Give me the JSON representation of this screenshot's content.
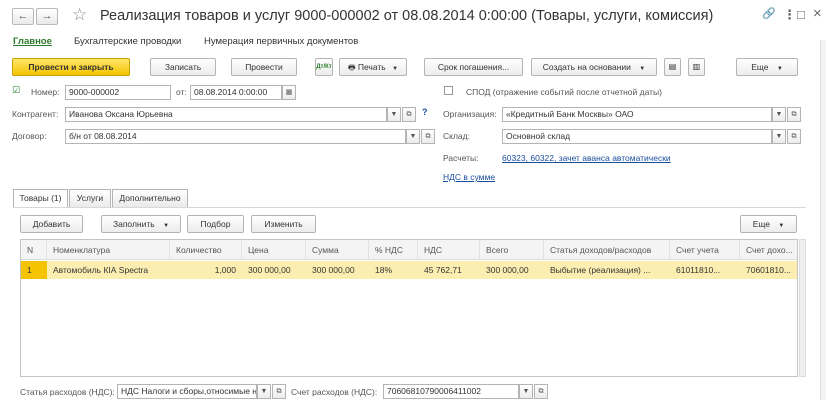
{
  "window": {
    "title": "Реализация товаров и услуг 9000-000002 от 08.08.2014 0:00:00 (Товары, услуги, комиссия)",
    "back_glyph": "←",
    "forward_glyph": "→",
    "star_glyph": "☆",
    "link_glyph": "🔗",
    "more_glyph": "⋮",
    "maximize_glyph": "□",
    "close_glyph": "×"
  },
  "nav_tabs": [
    "Главное",
    "Бухгалтерские проводки",
    "Нумерация первичных документов"
  ],
  "toolbar": {
    "post_close": "Провести и закрыть",
    "save": "Записать",
    "post": "Провести",
    "dtkt_icon": "Дт/Кт",
    "print": "Печать",
    "due_date": "Срок погашения...",
    "create_based": "Создать на основании",
    "more": "Еще"
  },
  "form": {
    "number_label": "Номер:",
    "number_value": "9000-000002",
    "date_label": "от:",
    "date_value": "08.08.2014  0:00:00",
    "spod_label": "СПОД (отражение событий после отчетной даты)",
    "counterparty_label": "Контрагент:",
    "counterparty_value": "Иванова Оксана Юрьевна",
    "contract_label": "Договор:",
    "contract_value": "б/н от 08.08.2014",
    "org_label": "Организация:",
    "org_value": "«Кредитный Банк Москвы» ОАО",
    "warehouse_label": "Склад:",
    "warehouse_value": "Основной склад",
    "settlements_label": "Расчеты:",
    "settlements_link": "60323, 60322, зачет аванса автоматически",
    "vat_link": "НДС в сумме",
    "help": "?"
  },
  "sub_tabs": [
    "Товары (1)",
    "Услуги",
    "Дополнительно"
  ],
  "table_toolbar": {
    "add": "Добавить",
    "fill": "Заполнить",
    "select": "Подбор",
    "change": "Изменить",
    "more": "Еще"
  },
  "table": {
    "columns": [
      "N",
      "Номенклатура",
      "Количество",
      "Цена",
      "Сумма",
      "% НДС",
      "НДС",
      "Всего",
      "Статья доходов/расходов",
      "Счет учета",
      "Счет дохо..."
    ],
    "rows": [
      [
        "1",
        "Автомобиль  КIА Spectra",
        "1,000",
        "300 000,00",
        "300 000,00",
        "18%",
        "45 762,71",
        "300 000,00",
        "Выбытие (реализация)  ...",
        "61011810...",
        "70601810..."
      ]
    ]
  },
  "bottom": {
    "expense_item_label": "Статья расходов (НДС):",
    "expense_item_value": "НДС Налоги и сборы,относимые н",
    "expense_account_label": "Счет расходов (НДС):",
    "expense_account_value": "70606810790006411002"
  },
  "colors": {
    "accent_yellow": "#f5c400",
    "selected_row": "#fbeeb0",
    "link": "#1a4d9c",
    "green_tab": "#2a7a2a"
  }
}
